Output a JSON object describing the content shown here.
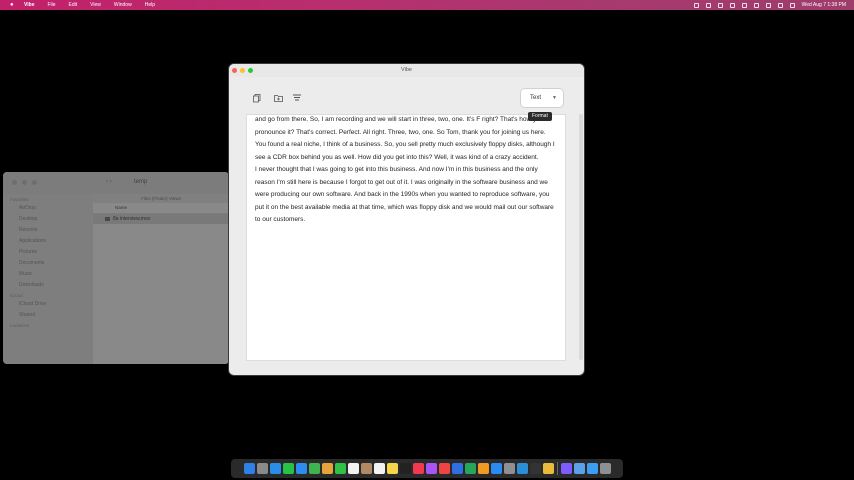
{
  "menubar": {
    "app_name": "Vibe",
    "items": [
      "File",
      "Edit",
      "View",
      "Window",
      "Help"
    ],
    "datetime": "Wed Aug 7  1:38 PM"
  },
  "finder": {
    "title": "temp",
    "header": "Files (Finder) Views",
    "column_name": "Name",
    "file": "8a interview.mov",
    "sidebar": [
      {
        "kind": "h",
        "label": "Favorites"
      },
      {
        "kind": "i",
        "label": "AirDrop"
      },
      {
        "kind": "i",
        "label": "Desktop"
      },
      {
        "kind": "i",
        "label": "Recents"
      },
      {
        "kind": "i",
        "label": "Applications"
      },
      {
        "kind": "i",
        "label": "Pictures"
      },
      {
        "kind": "i",
        "label": "Documents"
      },
      {
        "kind": "i",
        "label": "Music"
      },
      {
        "kind": "i",
        "label": "Downloads"
      },
      {
        "kind": "h",
        "label": "iCloud"
      },
      {
        "kind": "i",
        "label": "iCloud Drive"
      },
      {
        "kind": "i",
        "label": "Shared"
      },
      {
        "kind": "h",
        "label": "Locations"
      }
    ]
  },
  "vibe": {
    "title": "Vibe",
    "format_value": "Text",
    "tooltip": "Format",
    "transcript": [
      "and go from there. So, I am recording and we will start in three, two, one. It's F right? That's how you pronounce it? That's correct. Perfect. All right. Three, two, one. So Tom, thank you for joining us here. You found a real niche, I think of a business. So, you sell pretty much exclusively floppy disks, although I see a CDR box behind you as well. How did you get into this? Well, it was kind of a crazy accident.",
      "I never thought that I was going to get into this business. And now I'm in this business and the only reason I'm still here is because I forgot to get out of it. I was originally in the software business and we were producing our own software. And back in the 1990s when you wanted to reproduce software, you put it on the best available media at that time, which was floppy disk and we would mail out our software to our customers."
    ]
  },
  "dock": {
    "apps": [
      "finder",
      "launchpad",
      "safari",
      "messages",
      "mail",
      "maps",
      "photos",
      "facetime",
      "calendar",
      "contacts",
      "reminders",
      "notes",
      "tv",
      "music",
      "podcasts",
      "news",
      "keynote",
      "numbers",
      "pages",
      "app-store",
      "settings",
      "vscode",
      "terminal",
      "chrome",
      "vibe",
      "preview",
      "downloads",
      "trash"
    ],
    "colors": [
      "#2f7fe8",
      "#8a8a8a",
      "#2a8de8",
      "#27c346",
      "#2d8cf0",
      "#3fb34f",
      "#e8a23a",
      "#2fc247",
      "#f2f2f2",
      "#b08a64",
      "#f2f2f2",
      "#f5d54a",
      "#222222",
      "#f3394f",
      "#a855f7",
      "#ef4444",
      "#2f6fe4",
      "#26a65b",
      "#f29b24",
      "#2b8bf3",
      "#8e8e93",
      "#2a8fd6",
      "#333333",
      "#e9ba3c",
      "#7c5cff",
      "#5aa0ea",
      "#3d9df3",
      "#8e8e93"
    ]
  }
}
